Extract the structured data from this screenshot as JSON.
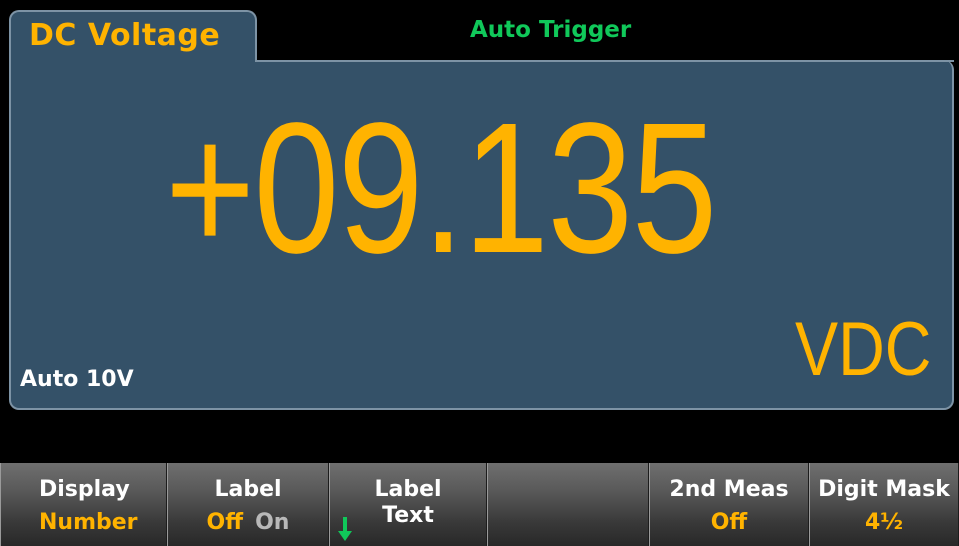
{
  "header": {
    "mode_tab": "DC Voltage",
    "trigger_status": "Auto Trigger"
  },
  "display": {
    "reading": "+09.135",
    "unit": "VDC",
    "range": "Auto 10V"
  },
  "softkeys": [
    {
      "top": "Display",
      "bottom": "Number"
    },
    {
      "top": "Label",
      "bottom_selected": "Off",
      "bottom_other": "On"
    },
    {
      "top": "Label",
      "bottom": "Text",
      "icon": "down-arrow-icon"
    },
    {
      "top": "",
      "bottom": ""
    },
    {
      "top": "2nd Meas",
      "bottom": "Off"
    },
    {
      "top": "Digit Mask",
      "bottom": "4½"
    }
  ],
  "colors": {
    "panel": "#345168",
    "accent": "#ffb300",
    "trigger": "#10c85a",
    "background": "#000000"
  }
}
